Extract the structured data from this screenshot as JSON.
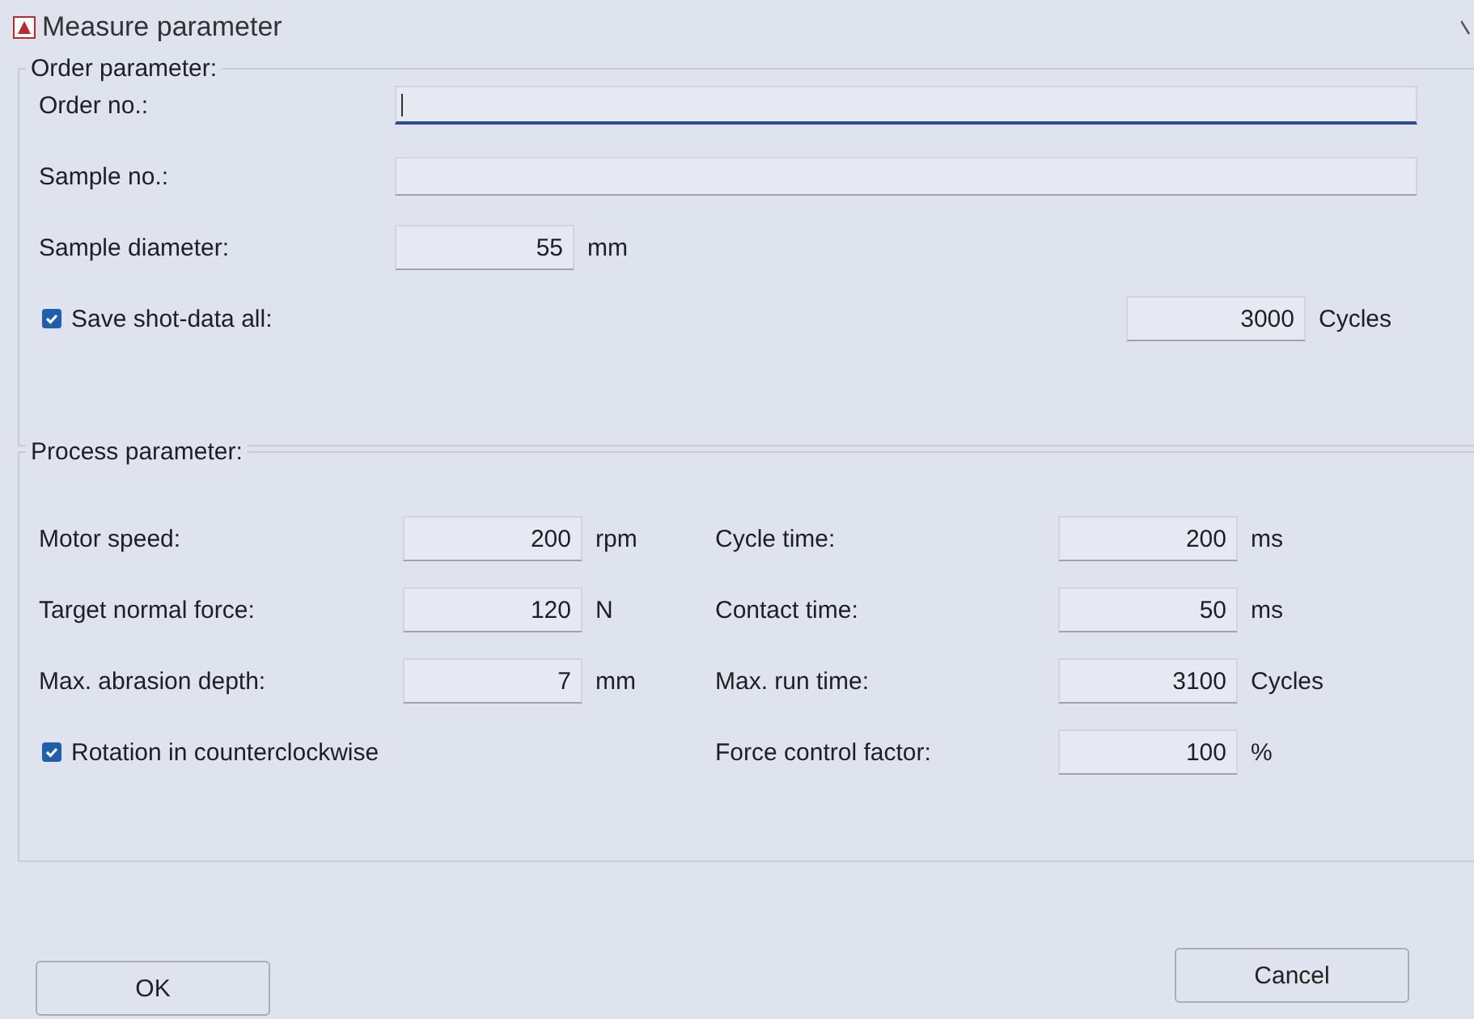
{
  "window": {
    "title": "Measure parameter"
  },
  "order_group": {
    "title": "Order parameter:",
    "text_fields": [
      {
        "label": "Order no.:",
        "focused": true
      },
      {
        "label": "Sample no.:",
        "focused": false
      }
    ],
    "sample_diameter": {
      "label": "Sample diameter:",
      "value": "55",
      "unit": "mm"
    },
    "save_shot_data": {
      "label": "Save shot-data all:",
      "checked": true,
      "value": "3000",
      "unit": "Cycles"
    }
  },
  "process_group": {
    "title": "Process parameter:",
    "left": [
      {
        "label": "Motor speed:",
        "value": "200",
        "unit": "rpm"
      },
      {
        "label": "Target normal force:",
        "value": "120",
        "unit": "N"
      },
      {
        "label": "Max. abrasion depth:",
        "value": "7",
        "unit": "mm"
      }
    ],
    "rotation": {
      "label": "Rotation in counterclockwise",
      "checked": true
    },
    "right": [
      {
        "label": "Cycle time:",
        "value": "200",
        "unit": "ms"
      },
      {
        "label": "Contact time:",
        "value": "50",
        "unit": "ms"
      },
      {
        "label": "Max. run time:",
        "value": "3100",
        "unit": "Cycles"
      },
      {
        "label": "Force control factor:",
        "value": "100",
        "unit": "%"
      }
    ]
  },
  "buttons": [
    {
      "label": "OK"
    },
    {
      "label": "Cancel"
    }
  ]
}
